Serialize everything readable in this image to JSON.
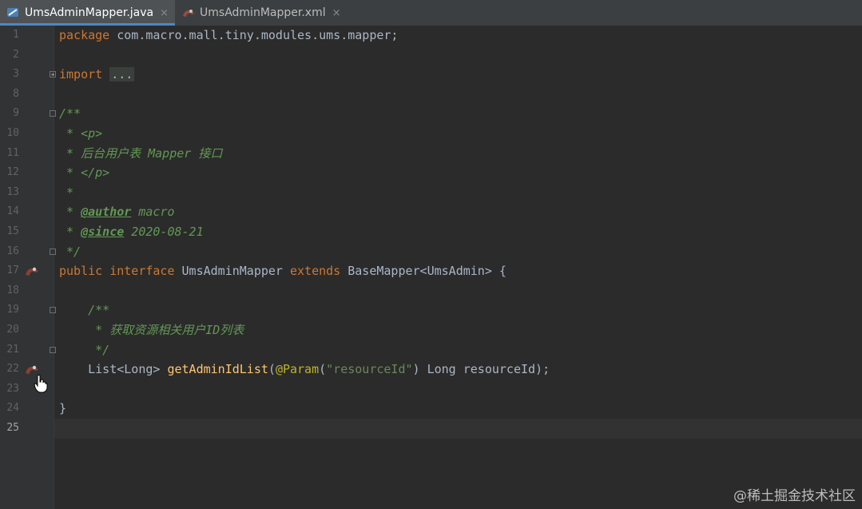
{
  "tabs": [
    {
      "label": "UmsAdminMapper.java",
      "close": "×",
      "active": true
    },
    {
      "label": "UmsAdminMapper.xml",
      "close": "×",
      "active": false
    }
  ],
  "line_numbers": [
    "1",
    "2",
    "3",
    "8",
    "9",
    "10",
    "11",
    "12",
    "13",
    "14",
    "15",
    "16",
    "17",
    "18",
    "19",
    "20",
    "21",
    "22",
    "23",
    "24",
    "25"
  ],
  "code": {
    "l1": {
      "kw": "package",
      "rest": " com.macro.mall.tiny.modules.ums.mapper;"
    },
    "l3": {
      "kw": "import",
      "fold": "..."
    },
    "l9": "/**",
    "l10": {
      "prefix": " * ",
      "html": "<p>"
    },
    "l11": " * 后台用户表 Mapper 接口",
    "l12": {
      "prefix": " * ",
      "html": "</p>"
    },
    "l13": " *",
    "l14": {
      "prefix": " * ",
      "tag": "@author",
      "text": " macro"
    },
    "l15": {
      "prefix": " * ",
      "tag": "@since",
      "text": " 2020-08-21"
    },
    "l16": " */",
    "l17": {
      "kw1": "public",
      "kw2": "interface",
      "name": "UmsAdminMapper",
      "kw3": "extends",
      "rest": "BaseMapper<UmsAdmin> {"
    },
    "l19": "    /**",
    "l20": "     * 获取资源相关用户ID列表",
    "l21": "     */",
    "l22": {
      "indent": "    ",
      "type": "List<Long> ",
      "method": "getAdminIdList",
      "open": "(",
      "anno": "@Param",
      "str_open": "(",
      "str": "\"resourceId\"",
      "str_close": ")",
      "rest": " Long resourceId);"
    },
    "l24": "}"
  },
  "watermark": "@稀土掘金技术社区",
  "colors": {
    "keyword": "#cc7832",
    "doc": "#629755",
    "method": "#ffc66d",
    "annotation": "#bbb529",
    "string": "#6a8759"
  },
  "icons": {
    "tab_java": "java-file-icon",
    "tab_xml": "mybatis-xml-icon",
    "gutter": "mybatis-navigate-icon",
    "cursor": "hand-cursor-icon"
  }
}
